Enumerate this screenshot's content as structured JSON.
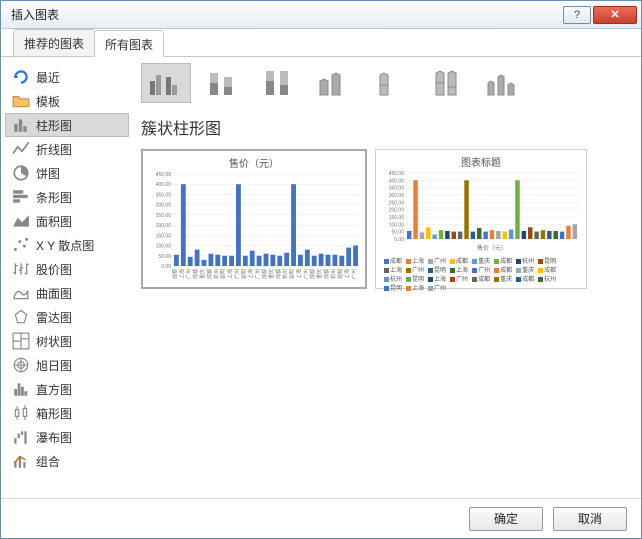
{
  "window": {
    "title": "插入图表"
  },
  "tabs": {
    "recommended": "推荐的图表",
    "all": "所有图表"
  },
  "sidebar": {
    "items": [
      {
        "label": "最近"
      },
      {
        "label": "模板"
      },
      {
        "label": "柱形图"
      },
      {
        "label": "折线图"
      },
      {
        "label": "饼图"
      },
      {
        "label": "条形图"
      },
      {
        "label": "面积图"
      },
      {
        "label": "X Y 散点图"
      },
      {
        "label": "股价图"
      },
      {
        "label": "曲面图"
      },
      {
        "label": "雷达图"
      },
      {
        "label": "树状图"
      },
      {
        "label": "旭日图"
      },
      {
        "label": "直方图"
      },
      {
        "label": "箱形图"
      },
      {
        "label": "瀑布图"
      },
      {
        "label": "组合"
      }
    ]
  },
  "heading": "簇状柱形图",
  "preview1": {
    "title": "售价（元）",
    "axis_label": ""
  },
  "preview2": {
    "title": "图表标题",
    "axis_label": "售价（元）"
  },
  "footer": {
    "ok": "确定",
    "cancel": "取消"
  },
  "chart_data": [
    {
      "type": "bar",
      "title": "售价（元）",
      "ylabel": "",
      "ylim": [
        0,
        450
      ],
      "yticks": [
        0,
        50,
        100,
        150,
        200,
        250,
        300,
        350,
        400,
        450
      ],
      "categories": [
        "成都",
        "上海",
        "广州",
        "成都",
        "重庆",
        "成都",
        "杭州",
        "昆明",
        "上海",
        "广州",
        "昆明",
        "上海",
        "广州",
        "成都",
        "重庆",
        "成都",
        "杭州",
        "昆明",
        "上海",
        "广州",
        "成都",
        "重庆",
        "成都",
        "杭州",
        "昆明",
        "上海",
        "广州"
      ],
      "values": [
        55,
        400,
        45,
        80,
        30,
        60,
        55,
        50,
        50,
        400,
        50,
        75,
        50,
        60,
        55,
        50,
        65,
        400,
        55,
        80,
        50,
        60,
        55,
        55,
        50,
        90,
        100
      ]
    },
    {
      "type": "bar",
      "title": "图表标题",
      "xlabel": "售价（元）",
      "ylim": [
        0,
        450
      ],
      "yticks": [
        0,
        50,
        100,
        150,
        200,
        250,
        300,
        350,
        400,
        450
      ],
      "series_legend": [
        "成都",
        "上海",
        "广州",
        "成都",
        "重庆",
        "成都",
        "杭州",
        "昆明",
        "上海",
        "广州",
        "昆明",
        "上海",
        "广州",
        "成都",
        "重庆",
        "成都",
        "杭州",
        "昆明",
        "上海",
        "广州",
        "成都",
        "重庆",
        "成都",
        "杭州",
        "昆明",
        "上海",
        "广州"
      ],
      "colors": [
        "#4472C4",
        "#ED7D31",
        "#A5A5A5",
        "#FFC000",
        "#5B9BD5",
        "#70AD47",
        "#264478",
        "#9E480E",
        "#636363",
        "#997300",
        "#255E91",
        "#43682B",
        "#4472C4",
        "#ED7D31",
        "#A5A5A5",
        "#FFC000",
        "#5B9BD5",
        "#70AD47",
        "#264478",
        "#9E480E",
        "#636363",
        "#997300",
        "#255E91",
        "#43682B",
        "#4472C4",
        "#ED7D31",
        "#A5A5A5"
      ],
      "values": [
        55,
        400,
        45,
        80,
        30,
        60,
        55,
        50,
        50,
        400,
        50,
        75,
        50,
        60,
        55,
        50,
        65,
        400,
        55,
        80,
        50,
        60,
        55,
        55,
        50,
        90,
        100
      ]
    }
  ]
}
